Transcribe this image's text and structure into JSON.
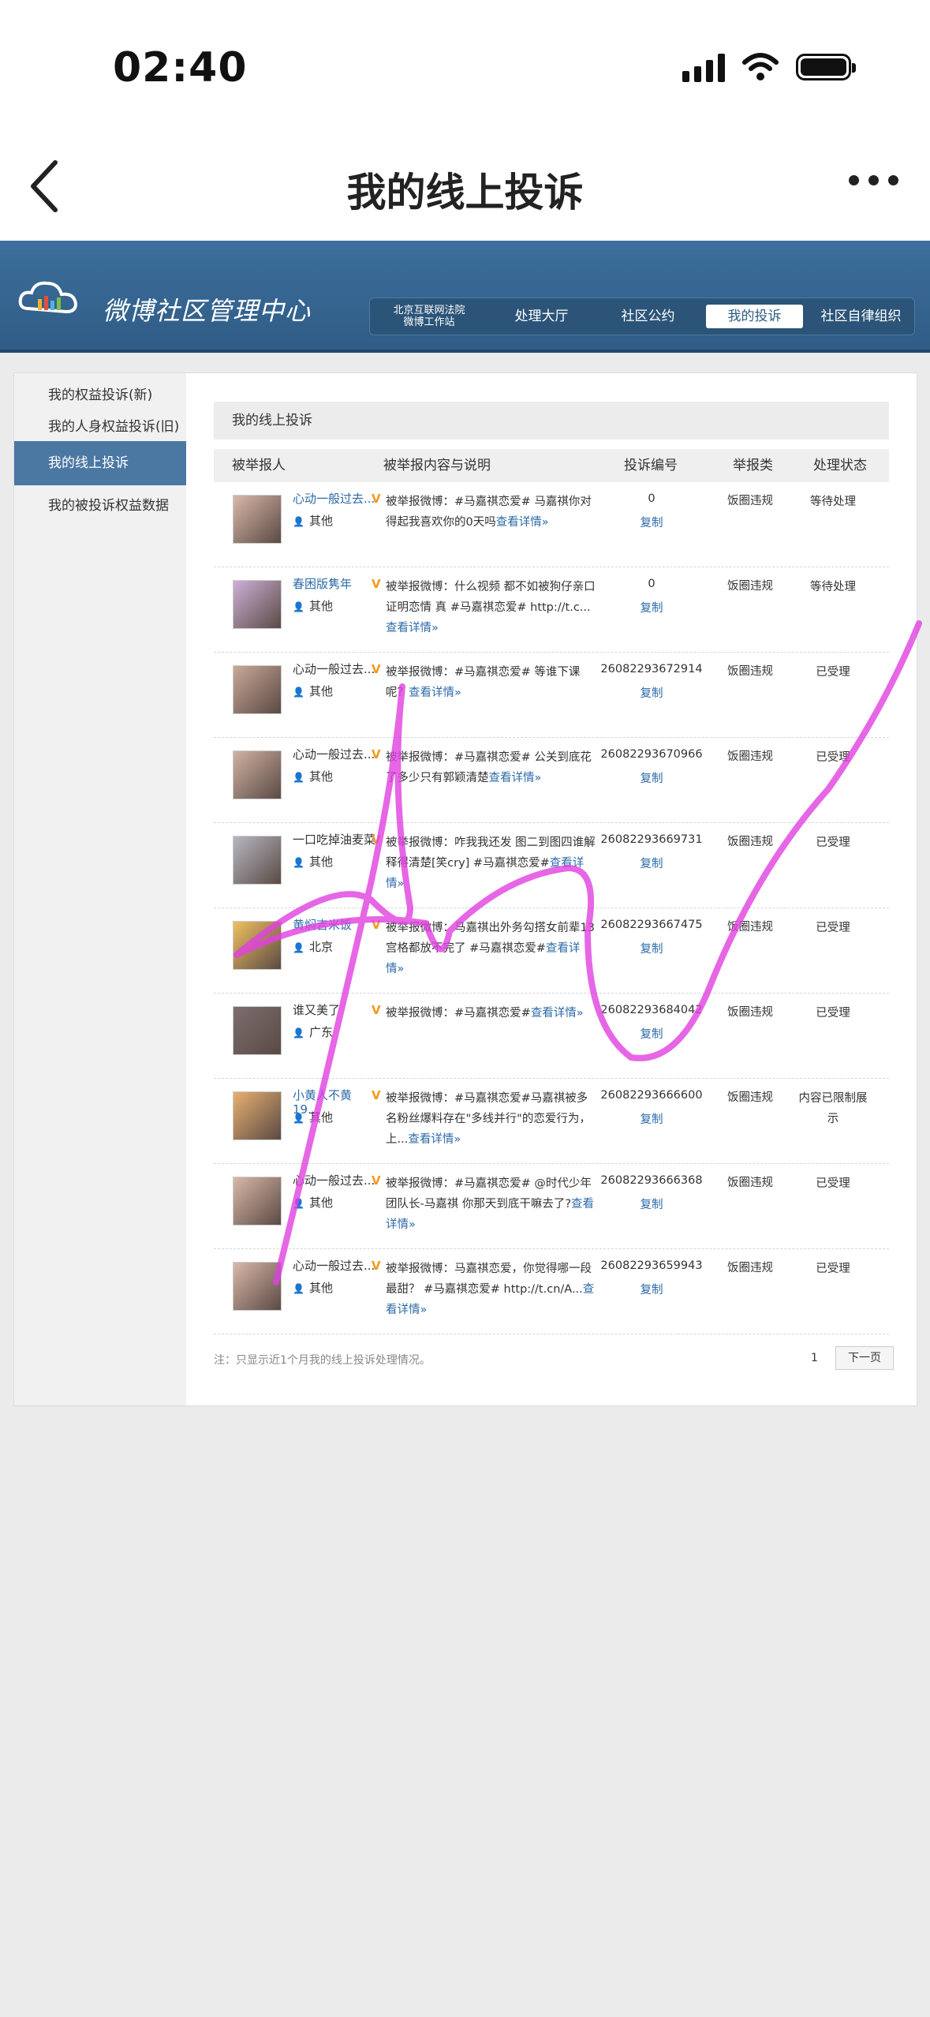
{
  "status": {
    "time": "02:40"
  },
  "nav": {
    "title": "我的线上投诉"
  },
  "header": {
    "logo_text": "微博社区管理中心",
    "court_line1": "北京互联网法院",
    "court_line2": "微博工作站",
    "nav_items": [
      "处理大厅",
      "社区公约",
      "我的投诉",
      "社区自律组织"
    ],
    "active_nav": "我的投诉"
  },
  "sidebar": {
    "items": [
      "我的权益投诉(新)",
      "我的人身权益投诉(旧)",
      "我的线上投诉",
      "我的被投诉权益数据"
    ],
    "active": "我的线上投诉"
  },
  "content": {
    "title": "我的线上投诉",
    "columns": [
      "被举报人",
      "被举报内容与说明",
      "投诉编号",
      "举报类",
      "处理状态"
    ],
    "copy_label": "复制",
    "rows": [
      {
        "name": "心动一般过去...",
        "location": "其他",
        "desc": "被举报微博：#马嘉祺恋爱# 马嘉祺你对得起我喜欢你的0天吗",
        "more": "查看详情»",
        "id": "0",
        "type": "饭圈违规",
        "status": "等待处理"
      },
      {
        "name": "春困版隽年",
        "location": "其他",
        "desc": "被举报微博：什么视频 都不如被狗仔亲口证明恋情 真 #马嘉祺恋爱# http://t.c...",
        "more": "查看详情»",
        "id": "0",
        "type": "饭圈违规",
        "status": "等待处理"
      },
      {
        "name": "心动一般过去...",
        "location": "其他",
        "desc": "被举报微博：#马嘉祺恋爱# 等谁下课呢？",
        "more": "查看详情»",
        "id": "26082293672914",
        "type": "饭圈违规",
        "status": "已受理"
      },
      {
        "name": "心动一般过去...",
        "location": "其他",
        "desc": "被举报微博：#马嘉祺恋爱# 公关到底花了多少只有郭颖清楚",
        "more": "查看详情»",
        "id": "26082293670966",
        "type": "饭圈违规",
        "status": "已受理"
      },
      {
        "name": "一口吃掉油麦菜",
        "location": "其他",
        "desc": "被举报微博：咋我我还发 图二到图四谁解释得清楚[笑cry] #马嘉祺恋爱#",
        "more": "查看详情»",
        "id": "26082293669731",
        "type": "饭圈违规",
        "status": "已受理"
      },
      {
        "name": "黄焖吉米饭",
        "location": "北京",
        "desc": "被举报微博：马嘉祺出外务勾搭女前辈13宫格都放不完了 #马嘉祺恋爱#",
        "more": "查看详情»",
        "id": "26082293667475",
        "type": "饭圈违规",
        "status": "已受理"
      },
      {
        "name": "谁又美了",
        "location": "广东",
        "desc": "被举报微博：#马嘉祺恋爱#",
        "more": "查看详情»",
        "id": "26082293684042",
        "type": "饭圈违规",
        "status": "已受理"
      },
      {
        "name": "小黄人不黄19...",
        "location": "其他",
        "desc": "被举报微博：#马嘉祺恋爱#马嘉祺被多名粉丝爆料存在\"多线并行\"的恋爱行为，上...",
        "more": "查看详情»",
        "id": "26082293666600",
        "type": "饭圈违规",
        "status": "内容已限制展示"
      },
      {
        "name": "心动一般过去...",
        "location": "其他",
        "desc": "被举报微博：#马嘉祺恋爱# @时代少年团队长-马嘉祺 你那天到底干嘛去了?",
        "more": "查看详情»",
        "id": "26082293666368",
        "type": "饭圈违规",
        "status": "已受理"
      },
      {
        "name": "心动一般过去...",
        "location": "其他",
        "desc": "被举报微博：马嘉祺恋爱，你觉得哪一段最甜？ #马嘉祺恋爱# http://t.cn/A...",
        "more": "查看详情»",
        "id": "26082293659943",
        "type": "饭圈违规",
        "status": "已受理"
      }
    ],
    "note": "注：只显示近1个月我的线上投诉处理情况。",
    "page": "1",
    "next_label": "下一页"
  },
  "colors": {
    "header_blue": "#3c6f9c",
    "link_blue": "#2d6aa8",
    "vip_orange": "#f39a1f",
    "scribble_magenta": "#e040e0"
  }
}
